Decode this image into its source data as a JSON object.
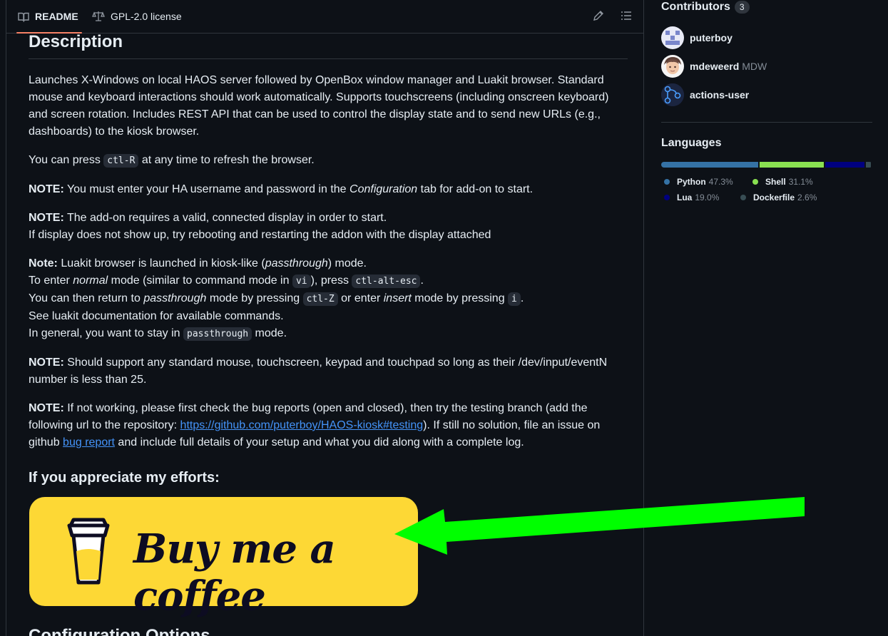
{
  "tabs": {
    "readme": "README",
    "license": "GPL-2.0 license"
  },
  "readme": {
    "heading": "Description",
    "p1": "Launches X-Windows on local HAOS server followed by OpenBox window manager and Luakit browser. Standard mouse and keyboard interactions should work automatically. Supports touchscreens (including onscreen keyboard) and screen rotation. Includes REST API that can be used to control the display state and to send new URLs (e.g., dashboards) to the kiosk browser.",
    "p2_a": "You can press ",
    "p2_code": "ctl-R",
    "p2_b": " at any time to refresh the browser.",
    "note_label": "NOTE:",
    "note_label_lower": "Note:",
    "p3_a": " You must enter your HA username and password in the ",
    "p3_em": "Configuration",
    "p3_b": " tab for add-on to start.",
    "p4_line1": " The add-on requires a valid, connected display in order to start.",
    "p4_line2": "If display does not show up, try rebooting and restarting the addon with the display attached",
    "p5_l1a": " Luakit browser is launched in kiosk-like (",
    "p5_l1em": "passthrough",
    "p5_l1b": ") mode.",
    "p5_l2a": "To enter ",
    "p5_l2em": "normal",
    "p5_l2b": " mode (similar to command mode in ",
    "p5_l2code1": "vi",
    "p5_l2c": "), press ",
    "p5_l2code2": "ctl-alt-esc",
    "p5_l2d": ".",
    "p5_l3a": "You can then return to ",
    "p5_l3em": "passthrough",
    "p5_l3b": " mode by pressing ",
    "p5_l3code1": "ctl-Z",
    "p5_l3c": " or enter ",
    "p5_l3em2": "insert",
    "p5_l3d": " mode by pressing ",
    "p5_l3code2": "i",
    "p5_l3e": ".",
    "p5_l4": "See luakit documentation for available commands.",
    "p5_l5a": "In general, you want to stay in ",
    "p5_l5code": "passthrough",
    "p5_l5b": " mode.",
    "p6": " Should support any standard mouse, touchscreen, keypad and touchpad so long as their /dev/input/eventN number is less than 25.",
    "p7_a": " If not working, please first check the bug reports (open and closed), then try the testing branch (add the following url to the repository: ",
    "p7_link": "https://github.com/puterboy/HAOS-kiosk#testing",
    "p7_b": "). If still no solution, file an issue on github ",
    "p7_link2": "bug report",
    "p7_c": " and include full details of your setup and what you did along with a complete log.",
    "appreciate": "If you appreciate my efforts:",
    "bmc_text": "Buy me a coffee",
    "config_heading": "Configuration Options"
  },
  "sidebar": {
    "contributors_title": "Contributors",
    "contributors_count": "3",
    "contributors": [
      {
        "login": "puterboy",
        "name": ""
      },
      {
        "login": "mdeweerd",
        "name": "MDW"
      },
      {
        "login": "actions-user",
        "name": ""
      }
    ],
    "languages_title": "Languages",
    "languages": [
      {
        "name": "Python",
        "pct": "47.3%",
        "value": 47.3,
        "color": "#3572A5"
      },
      {
        "name": "Shell",
        "pct": "31.1%",
        "value": 31.1,
        "color": "#89e051"
      },
      {
        "name": "Lua",
        "pct": "19.0%",
        "value": 19.0,
        "color": "#000080"
      },
      {
        "name": "Dockerfile",
        "pct": "2.6%",
        "value": 2.6,
        "color": "#384d54"
      }
    ]
  },
  "colors": {
    "accent_link": "#4493f8",
    "bmc_yellow": "#fdd835",
    "arrow_green": "#00ff00",
    "tab_underline": "#f78166"
  }
}
